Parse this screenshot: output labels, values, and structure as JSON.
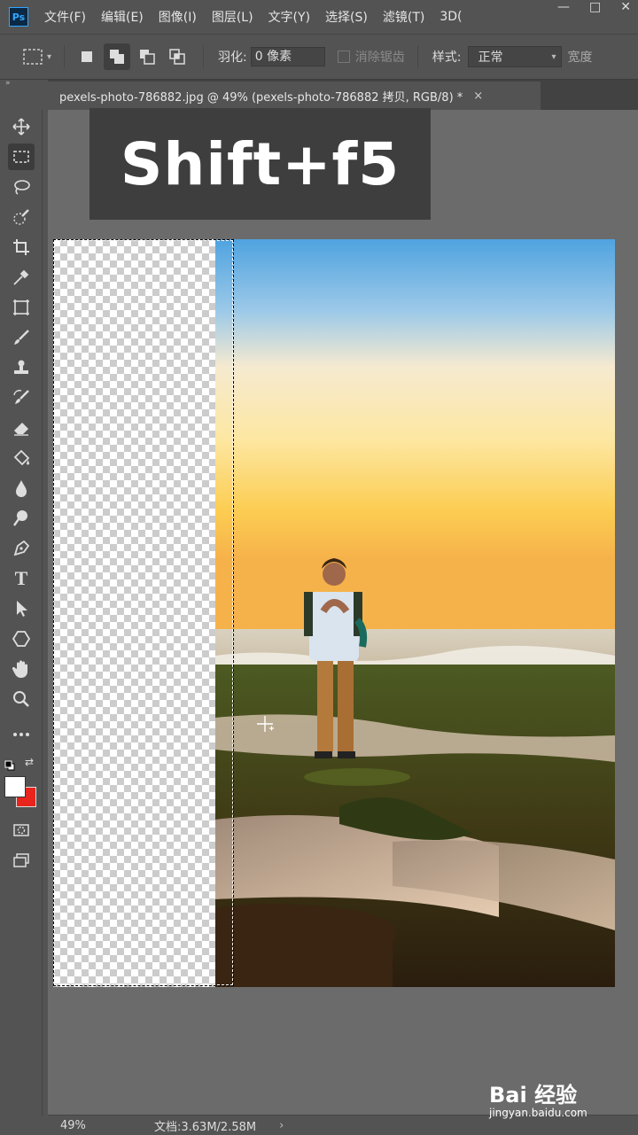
{
  "app": {
    "logo_text": "Ps"
  },
  "menu": [
    "文件(F)",
    "编辑(E)",
    "图像(I)",
    "图层(L)",
    "文字(Y)",
    "选择(S)",
    "滤镜(T)",
    "3D("
  ],
  "window_controls": {
    "minimize": "—",
    "restore": "□",
    "close": "✕"
  },
  "options": {
    "feather_label": "羽化:",
    "feather_value": "0 像素",
    "antialias_label": "消除锯齿",
    "antialias_checked": false,
    "style_label": "样式:",
    "style_value": "正常",
    "width_label": "宽度"
  },
  "tab": {
    "title": "pexels-photo-786882.jpg @ 49% (pexels-photo-786882 拷贝, RGB/8) *",
    "close": "×"
  },
  "overlay": {
    "shortcut": "Shift+f5"
  },
  "colors": {
    "foreground": "#ffffff",
    "background": "#e8241c",
    "ps_blue": "#31a8ff"
  },
  "tools": [
    "move-icon",
    "rectangular-marquee-icon",
    "lasso-icon",
    "quick-selection-icon",
    "crop-icon",
    "eyedropper-icon",
    "frame-icon",
    "brush-icon",
    "stamp-icon",
    "history-brush-icon",
    "eraser-icon",
    "paint-bucket-icon",
    "blur-icon",
    "dodge-icon",
    "pen-icon",
    "type-icon",
    "path-selection-icon",
    "shape-icon",
    "hand-icon",
    "zoom-icon",
    "more-icon"
  ],
  "tool_labels": {
    "type": "T"
  },
  "status": {
    "zoom": "49%",
    "doc_info": "文档:3.63M/2.58M",
    "arrow": "›"
  },
  "watermark": {
    "main": "Bai 经验",
    "sub": "jingyan.baidu.com"
  }
}
